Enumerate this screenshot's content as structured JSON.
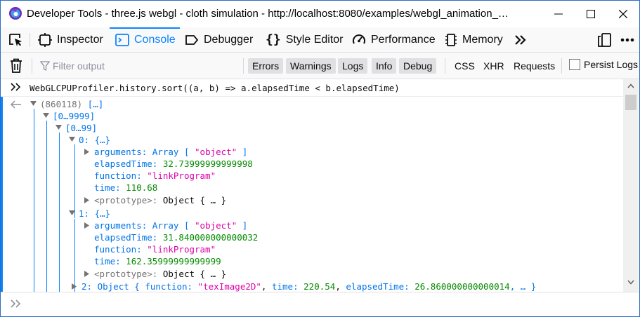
{
  "window": {
    "title": "Developer Tools - three.js webgl - cloth simulation - http://localhost:8080/examples/webgl_animation_…"
  },
  "toolbar": {
    "tabs": [
      {
        "label": "Inspector",
        "icon": "inspector-icon"
      },
      {
        "label": "Console",
        "icon": "console-icon"
      },
      {
        "label": "Debugger",
        "icon": "debugger-icon"
      },
      {
        "label": "Style Editor",
        "icon": "style-editor-icon"
      },
      {
        "label": "Performance",
        "icon": "performance-icon"
      },
      {
        "label": "Memory",
        "icon": "memory-icon"
      }
    ]
  },
  "filterbar": {
    "placeholder": "Filter output",
    "levels": [
      "Errors",
      "Warnings",
      "Logs",
      "Info",
      "Debug"
    ],
    "requests": [
      "CSS",
      "XHR",
      "Requests"
    ],
    "persist_label": "Persist Logs"
  },
  "console": {
    "command": "WebGLCPUProfiler.history.sort((a, b) => a.elapsedTime < b.elapsedTime)",
    "result": {
      "root_count": "(860118)",
      "root_preview": "[…]",
      "range1": "[0…9999]",
      "range2": "[0…99]",
      "items": [
        {
          "index": "0:",
          "preview": "{…}",
          "arguments_key": "arguments:",
          "arguments_type": "Array",
          "arguments_open": "[",
          "arguments_value": "\"object\"",
          "arguments_close": "]",
          "elapsed_key": "elapsedTime:",
          "elapsed_value": "32.73999999999998",
          "function_key": "function:",
          "function_value": "\"linkProgram\"",
          "time_key": "time:",
          "time_value": "110.68",
          "proto_key": "<prototype>:",
          "proto_value": "Object { … }"
        },
        {
          "index": "1:",
          "preview": "{…}",
          "arguments_key": "arguments:",
          "arguments_type": "Array",
          "arguments_open": "[",
          "arguments_value": "\"object\"",
          "arguments_close": "]",
          "elapsed_key": "elapsedTime:",
          "elapsed_value": "31.840000000000032",
          "function_key": "function:",
          "function_value": "\"linkProgram\"",
          "time_key": "time:",
          "time_value": "162.35999999999999",
          "proto_key": "<prototype>:",
          "proto_value": "Object { … }"
        }
      ],
      "item2": {
        "index": "2:",
        "type": "Object",
        "open": "{",
        "function_key": "function:",
        "function_value": "\"texImage2D\"",
        "sep1": ",",
        "time_key": "time:",
        "time_value": "220.54",
        "sep2": ",",
        "elapsed_key": "elapsedTime:",
        "elapsed_value": "26.860000000000014",
        "tail": ", … }"
      }
    }
  },
  "colors": {
    "accent": "#0a84ff",
    "key": "#0074e8",
    "number": "#058b00",
    "string": "#dd00a9",
    "muted": "#737373"
  }
}
